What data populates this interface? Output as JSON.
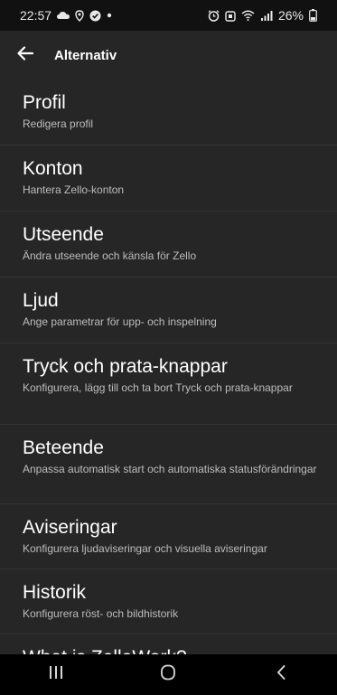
{
  "status_bar": {
    "time": "22:57",
    "battery": "26%",
    "left_icons": [
      "cloud-icon",
      "location-icon",
      "check-circle-icon",
      "dot-icon"
    ],
    "right_icons": [
      "alarm-icon",
      "notification-icon",
      "wifi-icon",
      "signal-icon",
      "battery-icon"
    ]
  },
  "app_bar": {
    "title": "Alternativ",
    "back_icon": "arrow-left-icon"
  },
  "settings": [
    {
      "title": "Profil",
      "subtitle": "Redigera profil"
    },
    {
      "title": "Konton",
      "subtitle": "Hantera Zello-konton"
    },
    {
      "title": "Utseende",
      "subtitle": "Ändra utseende och känsla för Zello"
    },
    {
      "title": "Ljud",
      "subtitle": "Ange parametrar för upp- och inspelning"
    },
    {
      "title": "Tryck och prata-knappar",
      "subtitle": "Konfigurera, lägg till och ta bort Tryck och prata-knappar"
    },
    {
      "title": "Beteende",
      "subtitle": "Anpassa automatisk start och automatiska statusförändringar"
    },
    {
      "title": "Aviseringar",
      "subtitle": "Konfigurera ljudaviseringar och visuella aviseringar"
    },
    {
      "title": "Historik",
      "subtitle": "Konfigurera röst- och bildhistorik"
    },
    {
      "title": "What is ZelloWork?",
      "subtitle": ""
    }
  ],
  "nav_bar": {
    "buttons": [
      "recent-apps-icon",
      "home-icon",
      "back-icon"
    ]
  },
  "colors": {
    "background": "#262626",
    "status_bar": "#111111",
    "divider": "#333333",
    "subtitle": "#bdbdbd"
  }
}
